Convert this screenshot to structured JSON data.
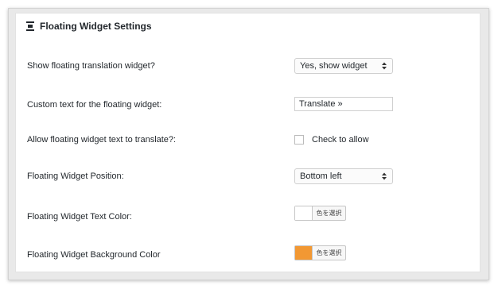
{
  "header": {
    "title": "Floating Widget Settings",
    "icon": "menu-icon"
  },
  "rows": [
    {
      "label": "Show floating translation widget?",
      "control": "select",
      "value": "Yes, show widget"
    },
    {
      "label": "Custom text for the floating widget:",
      "control": "text",
      "value": "Translate »"
    },
    {
      "label": "Allow floating widget text to translate?:",
      "control": "checkbox",
      "checked": false,
      "option_label": "Check to allow"
    },
    {
      "label": "Floating Widget Position:",
      "control": "select",
      "value": "Bottom left"
    },
    {
      "label": "Floating Widget Text Color:",
      "control": "color",
      "button_label": "色を選択",
      "color": "#ffffff"
    },
    {
      "label": "Floating Widget Background Color",
      "control": "color",
      "button_label": "色を選択",
      "color": "#f29833"
    }
  ]
}
